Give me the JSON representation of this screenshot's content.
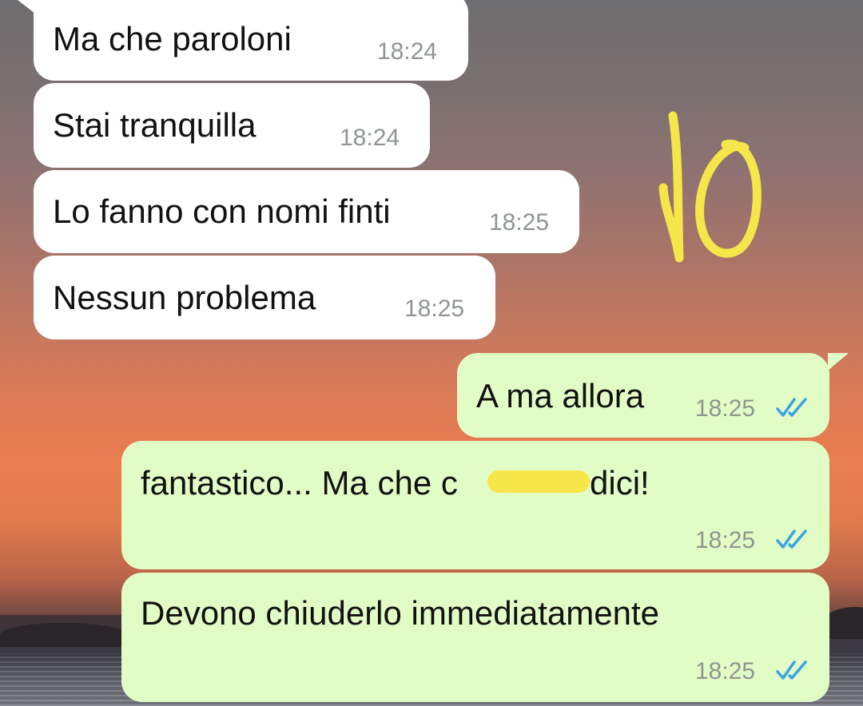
{
  "chat": {
    "incoming": [
      {
        "text": "Ma che paroloni",
        "time": "18:24"
      },
      {
        "text": "Stai tranquilla",
        "time": "18:24"
      },
      {
        "text": "Lo fanno con nomi finti",
        "time": "18:25"
      },
      {
        "text": "Nessun problema",
        "time": "18:25"
      }
    ],
    "outgoing": [
      {
        "text": "A ma allora",
        "time": "18:25",
        "status": "read"
      },
      {
        "text_before": "fantastico... Ma che c",
        "text_after": " dici!",
        "time": "18:25",
        "status": "read"
      },
      {
        "text": "Devono chiuderlo immediatamente",
        "time": "18:25",
        "status": "read"
      }
    ]
  },
  "colors": {
    "incoming_bubble": "#ffffff",
    "outgoing_bubble": "#e2fcc6",
    "read_tick": "#3aa3e3",
    "timestamp": "#8f9690",
    "highlight": "#f7e64a"
  },
  "icons": {
    "read_status": "double-check-icon",
    "annotation": "handwritten-10-doodle"
  }
}
